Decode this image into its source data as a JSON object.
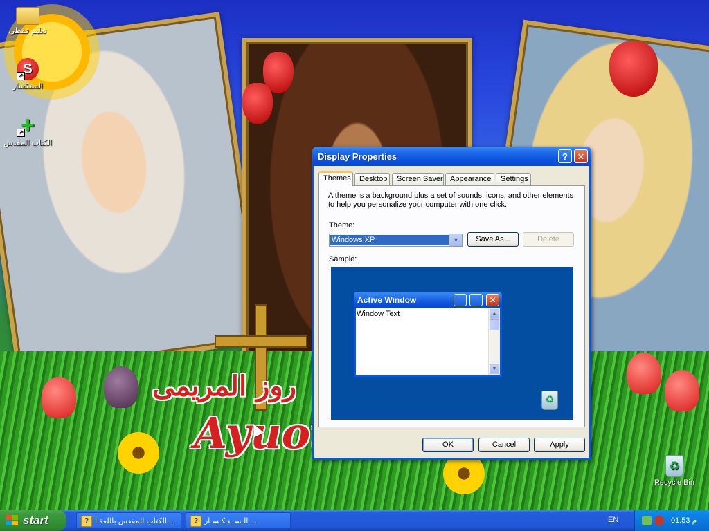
{
  "desktop": {
    "icons": [
      {
        "label": "تعليم فقطي",
        "icon": "folder-icon"
      },
      {
        "label": "السنكسار",
        "icon": "synaxarium-app-icon"
      },
      {
        "label": "الكتاب المقدس",
        "icon": "bible-app-icon"
      },
      {
        "label": "Recycle Bin",
        "icon": "recycle-bin-icon"
      }
    ],
    "wallpaper_text": {
      "arabic": "روز المريمى",
      "latin": "Ayuot"
    }
  },
  "dialog": {
    "title": "Display Properties",
    "help_symbol": "?",
    "close_symbol": "✕",
    "tabs": [
      "Themes",
      "Desktop",
      "Screen Saver",
      "Appearance",
      "Settings"
    ],
    "active_tab": "Themes",
    "description": "A theme is a background plus a set of sounds, icons, and other elements to help you personalize your computer with one click.",
    "theme_label": "Theme:",
    "theme_value": "Windows XP",
    "save_as_label": "Save As...",
    "delete_label": "Delete",
    "sample_label": "Sample:",
    "sample": {
      "window_title": "Active Window",
      "window_text": "Window Text"
    },
    "ok_label": "OK",
    "cancel_label": "Cancel",
    "apply_label": "Apply"
  },
  "taskbar": {
    "start_label": "start",
    "tasks": [
      {
        "label": "الكتاب المقدس باللغة ا...",
        "icon": "help-book-icon"
      },
      {
        "label": "الـســنـكـسـار ...",
        "icon": "help-book-icon"
      }
    ],
    "language": "EN",
    "clock": "01:53 م"
  },
  "colors": {
    "xp_blue": "#0a54e2",
    "start_green": "#3c9a3c",
    "dialog_face": "#ece9d8",
    "sample_background": "#034ea0"
  }
}
